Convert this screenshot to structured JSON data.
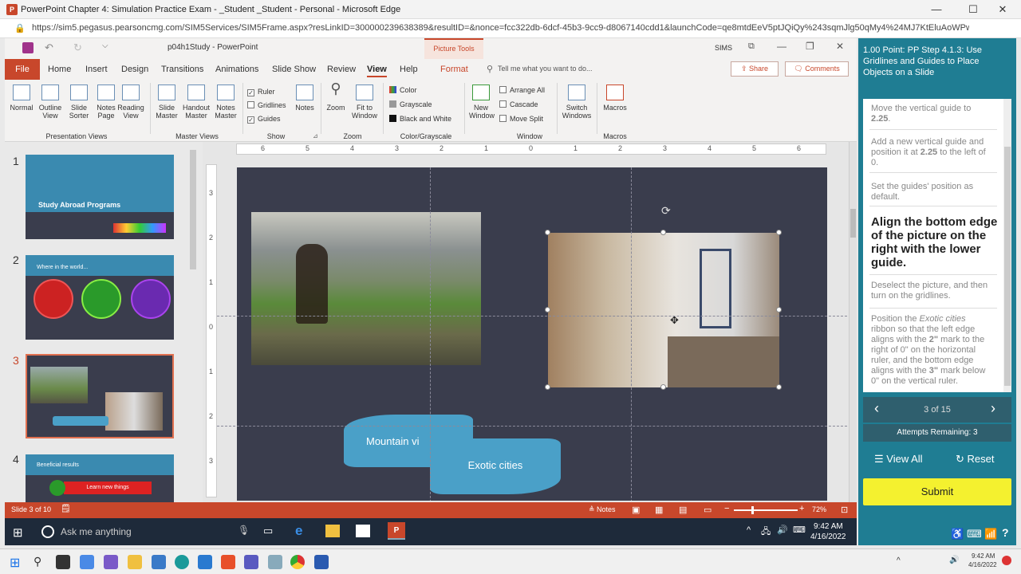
{
  "browser": {
    "title": "PowerPoint Chapter 4: Simulation Practice Exam - _Student _Student - Personal - Microsoft Edge",
    "url": "https://sim5.pegasus.pearsoncmg.com/SIM5Services/SIM5Frame.aspx?resLinkID=300000239638389&resultID=&nonce=fcc322db-6dcf-45b3-9cc9-d8067140cdd1&launchCode=qe8mtdEeV5ptJQiQy%243sqmJlg50qMy4%24MJ7KtEluAoWPw%..."
  },
  "ppt": {
    "filename": "p04h1Study - PowerPoint",
    "contextual": "Picture Tools",
    "sims_label": "SIMS",
    "tabs": [
      "File",
      "Home",
      "Insert",
      "Design",
      "Transitions",
      "Animations",
      "Slide Show",
      "Review",
      "View",
      "Help",
      "Format"
    ],
    "tell_me": "Tell me what you want to do...",
    "share": "Share",
    "comments": "Comments",
    "ribbon": {
      "normal": "Normal",
      "outline": "Outline View",
      "slide_sorter": "Slide Sorter",
      "notes_page": "Notes Page",
      "reading": "Reading View",
      "slide_master": "Slide Master",
      "handout_master": "Handout Master",
      "notes_master": "Notes Master",
      "ruler": "Ruler",
      "gridlines": "Gridlines",
      "guides": "Guides",
      "notes": "Notes",
      "zoom": "Zoom",
      "fit": "Fit to Window",
      "color": "Color",
      "grayscale": "Grayscale",
      "bw": "Black and White",
      "new_window": "New Window",
      "arrange_all": "Arrange All",
      "cascade": "Cascade",
      "move_split": "Move Split",
      "switch_windows": "Switch Windows",
      "macros": "Macros",
      "groups": [
        "Presentation Views",
        "Master Views",
        "Show",
        "Zoom",
        "Color/Grayscale",
        "Window",
        "Macros"
      ]
    },
    "ruler_labels": [
      "6",
      "5",
      "4",
      "3",
      "2",
      "1",
      "0",
      "1",
      "2",
      "3",
      "4",
      "5",
      "6"
    ],
    "vruler_labels": [
      "3",
      "2",
      "1",
      "0",
      "1",
      "2",
      "3"
    ],
    "thumbs": [
      {
        "num": "1",
        "title": "Study Abroad Programs"
      },
      {
        "num": "2",
        "title": "Where in the world..."
      },
      {
        "num": "3",
        "title": ""
      },
      {
        "num": "4",
        "title": "Beneficial results",
        "item": "Learn new things"
      }
    ],
    "slide": {
      "banner1": "Mountain vi",
      "banner2": "Exotic cities"
    },
    "status": {
      "slide": "Slide 3 of 10",
      "notes": "Notes",
      "zoom": "72%"
    }
  },
  "taskbar": {
    "search": "Ask me anything",
    "time": "9:42 AM",
    "date": "4/16/2022"
  },
  "systray": {
    "time": "9:42 AM",
    "date": "4/16/2022"
  },
  "sims": {
    "title": "1.00 Point: PP Step 4.1.3: Use Gridlines and Guides to Place Objects on a Slide",
    "steps": [
      {
        "pre": "Move the vertical guide to ",
        "bold": "2.25",
        "post": "."
      },
      {
        "pre": "Add a new vertical guide and position it at ",
        "bold": "2.25",
        "post": " to the left of 0."
      },
      {
        "pre": "Set the guides' position as default.",
        "bold": "",
        "post": ""
      }
    ],
    "current": "Align the bottom edge of the picture on the right with the lower guide.",
    "after1": "Deselect the picture, and then turn on the gridlines.",
    "after2_a": "Position the ",
    "after2_i": "Exotic cities",
    "after2_b": " ribbon so that the left edge aligns with the ",
    "after2_c": "2\"",
    "after2_d": " mark to the right of 0\" on the horizontal ruler, and the bottom edge aligns with the ",
    "after2_e": "3\"",
    "after2_f": " mark below 0\" on the vertical ruler.",
    "pager": "3 of 15",
    "attempts": "Attempts Remaining: 3",
    "view_all": "View All",
    "reset": "Reset",
    "submit": "Submit"
  }
}
